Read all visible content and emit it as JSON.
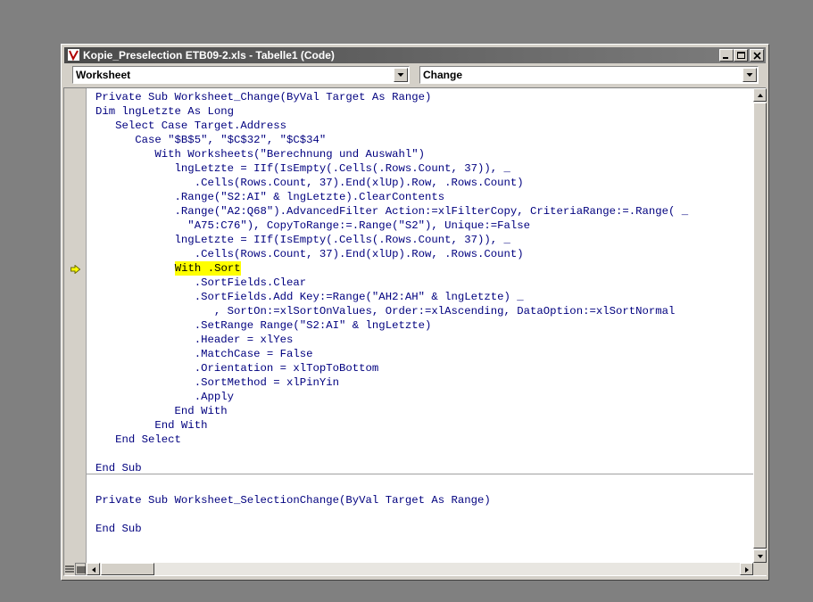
{
  "window": {
    "title": "Kopie_Preselection ETB09-2.xls - Tabelle1 (Code)"
  },
  "object_combo": {
    "value": "Worksheet"
  },
  "procedure_combo": {
    "value": "Change"
  },
  "editor": {
    "execution_line_index": 12,
    "lines": [
      "Private Sub Worksheet_Change(ByVal Target As Range)",
      "Dim lngLetzte As Long",
      "   Select Case Target.Address",
      "      Case \"$B$5\", \"$C$32\", \"$C$34\"",
      "         With Worksheets(\"Berechnung und Auswahl\")",
      "            lngLetzte = IIf(IsEmpty(.Cells(.Rows.Count, 37)), _",
      "               .Cells(Rows.Count, 37).End(xlUp).Row, .Rows.Count)",
      "            .Range(\"S2:AI\" & lngLetzte).ClearContents",
      "            .Range(\"A2:Q68\").AdvancedFilter Action:=xlFilterCopy, CriteriaRange:=.Range( _",
      "              \"A75:C76\"), CopyToRange:=.Range(\"S2\"), Unique:=False",
      "            lngLetzte = IIf(IsEmpty(.Cells(.Rows.Count, 37)), _",
      "               .Cells(Rows.Count, 37).End(xlUp).Row, .Rows.Count)",
      "            With .Sort",
      "               .SortFields.Clear",
      "               .SortFields.Add Key:=Range(\"AH2:AH\" & lngLetzte) _",
      "                  , SortOn:=xlSortOnValues, Order:=xlAscending, DataOption:=xlSortNormal",
      "               .SetRange Range(\"S2:AI\" & lngLetzte)",
      "               .Header = xlYes",
      "               .MatchCase = False",
      "               .Orientation = xlTopToBottom",
      "               .SortMethod = xlPinYin",
      "               .Apply",
      "            End With",
      "         End With",
      "   End Select",
      "",
      "End Sub",
      "",
      "Private Sub Worksheet_SelectionChange(ByVal Target As Range)",
      "",
      "End Sub"
    ]
  },
  "colors": {
    "desktop": "#808080",
    "window_face": "#d4d0c8",
    "code_text": "#00007f",
    "execution_highlight": "#ffff00",
    "execution_arrow": "#ffff00"
  },
  "icons": {
    "app": "vba-code-window-icon",
    "minimize": "minimize-icon",
    "maximize": "maximize-icon",
    "close": "close-icon",
    "execution_pointer": "execution-arrow-icon"
  }
}
